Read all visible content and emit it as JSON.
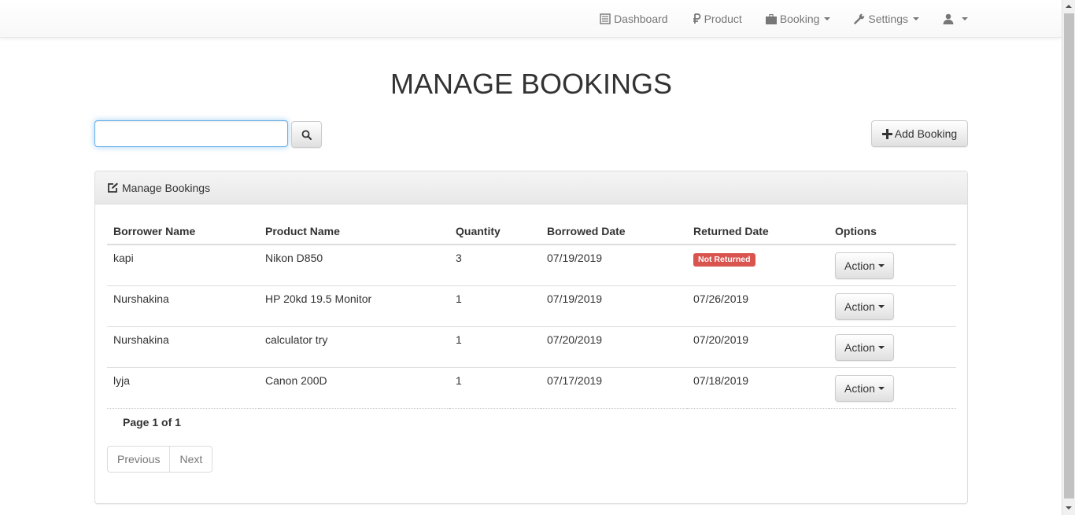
{
  "nav": {
    "dashboard": "Dashboard",
    "product": "Product",
    "booking": "Booking",
    "settings": "Settings"
  },
  "page_title": "MANAGE BOOKINGS",
  "search": {
    "value": "",
    "placeholder": ""
  },
  "add_button": "Add Booking",
  "panel_title": "Manage Bookings",
  "table": {
    "headers": [
      "Borrower Name",
      "Product Name",
      "Quantity",
      "Borrowed Date",
      "Returned Date",
      "Options"
    ],
    "rows": [
      {
        "borrower": "kapi",
        "product": "Nikon D850",
        "quantity": "3",
        "borrowed": "07/19/2019",
        "returned": "",
        "status_badge": "Not Returned",
        "action": "Action"
      },
      {
        "borrower": "Nurshakina",
        "product": "HP 20kd 19.5 Monitor",
        "quantity": "1",
        "borrowed": "07/19/2019",
        "returned": "07/26/2019",
        "action": "Action"
      },
      {
        "borrower": "Nurshakina",
        "product": "calculator try",
        "quantity": "1",
        "borrowed": "07/20/2019",
        "returned": "07/20/2019",
        "action": "Action"
      },
      {
        "borrower": "lyja",
        "product": "Canon 200D",
        "quantity": "1",
        "borrowed": "07/17/2019",
        "returned": "07/18/2019",
        "action": "Action"
      }
    ]
  },
  "pagination": {
    "info": "Page 1 of 1",
    "previous": "Previous",
    "next": "Next"
  },
  "colors": {
    "danger": "#d9534f",
    "focus": "#66afe9"
  }
}
